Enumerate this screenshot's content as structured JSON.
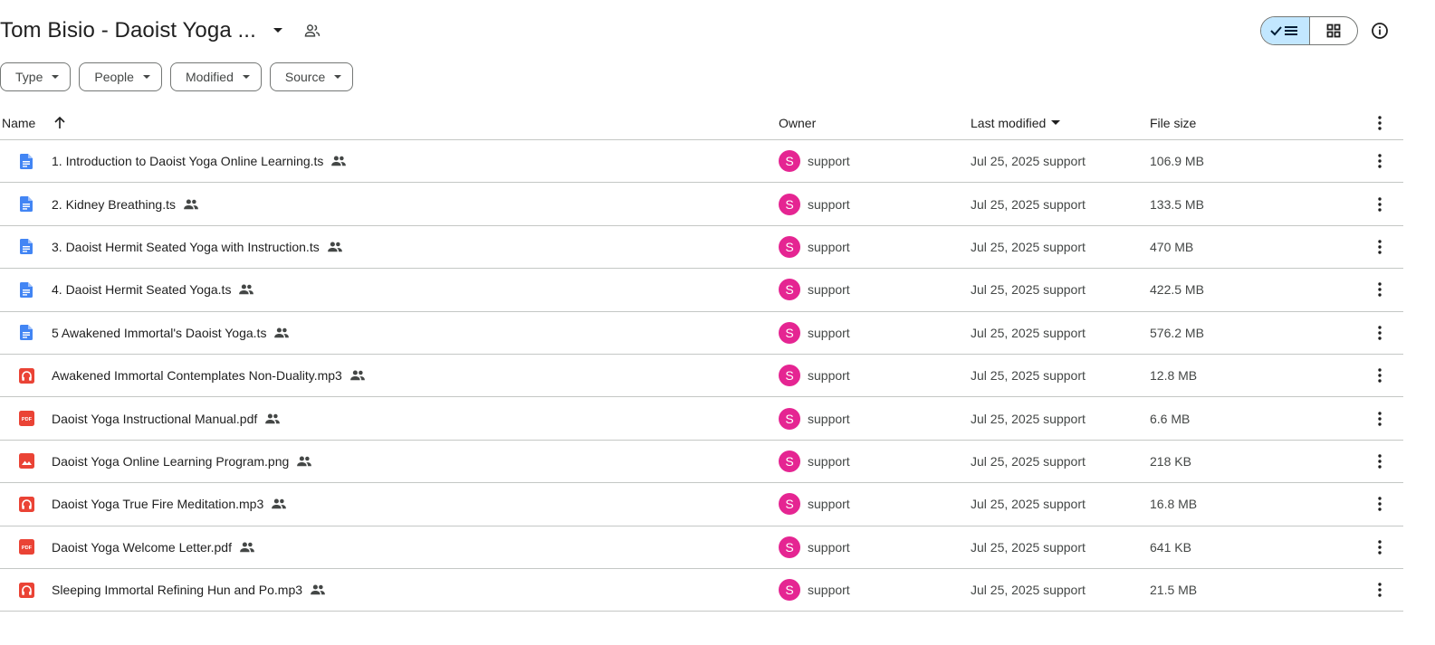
{
  "header": {
    "title": "Tom Bisio - Daoist Yoga ...",
    "caret_icon": "arrow-drop-down-icon",
    "shared_icon": "people-outline-icon"
  },
  "view_toggle": {
    "active": "list",
    "list_icon": "check-list-icon",
    "grid_icon": "grid-icon"
  },
  "info_icon": "info-icon",
  "filters": [
    {
      "label": "Type"
    },
    {
      "label": "People"
    },
    {
      "label": "Modified"
    },
    {
      "label": "Source"
    }
  ],
  "columns": {
    "name": "Name",
    "owner": "Owner",
    "modified": "Last modified",
    "size": "File size"
  },
  "colors": {
    "doc_blue": "#4285f4",
    "red": "#ea4335",
    "avatar_pink": "#e52592",
    "toggle_active": "#c2e7ff"
  },
  "files": [
    {
      "name": "1. Introduction to Daoist Yoga Online Learning.ts",
      "type": "doc",
      "owner_initial": "S",
      "owner": "support",
      "modified": "Jul 25, 2025 support",
      "size": "106.9 MB"
    },
    {
      "name": "2. Kidney Breathing.ts",
      "type": "doc",
      "owner_initial": "S",
      "owner": "support",
      "modified": "Jul 25, 2025 support",
      "size": "133.5 MB"
    },
    {
      "name": "3. Daoist Hermit Seated Yoga with Instruction.ts",
      "type": "doc",
      "owner_initial": "S",
      "owner": "support",
      "modified": "Jul 25, 2025 support",
      "size": "470 MB"
    },
    {
      "name": "4. Daoist Hermit Seated Yoga.ts",
      "type": "doc",
      "owner_initial": "S",
      "owner": "support",
      "modified": "Jul 25, 2025 support",
      "size": "422.5 MB"
    },
    {
      "name": "5 Awakened Immortal's Daoist Yoga.ts",
      "type": "doc",
      "owner_initial": "S",
      "owner": "support",
      "modified": "Jul 25, 2025 support",
      "size": "576.2 MB"
    },
    {
      "name": "Awakened Immortal Contemplates Non-Duality.mp3",
      "type": "audio",
      "owner_initial": "S",
      "owner": "support",
      "modified": "Jul 25, 2025 support",
      "size": "12.8 MB"
    },
    {
      "name": "Daoist Yoga Instructional Manual.pdf",
      "type": "pdf",
      "owner_initial": "S",
      "owner": "support",
      "modified": "Jul 25, 2025 support",
      "size": "6.6 MB"
    },
    {
      "name": "Daoist Yoga Online Learning Program.png",
      "type": "image",
      "owner_initial": "S",
      "owner": "support",
      "modified": "Jul 25, 2025 support",
      "size": "218 KB"
    },
    {
      "name": "Daoist Yoga True Fire Meditation.mp3",
      "type": "audio",
      "owner_initial": "S",
      "owner": "support",
      "modified": "Jul 25, 2025 support",
      "size": "16.8 MB"
    },
    {
      "name": "Daoist Yoga Welcome Letter.pdf",
      "type": "pdf",
      "owner_initial": "S",
      "owner": "support",
      "modified": "Jul 25, 2025 support",
      "size": "641 KB"
    },
    {
      "name": "Sleeping Immortal Refining Hun and Po.mp3",
      "type": "audio",
      "owner_initial": "S",
      "owner": "support",
      "modified": "Jul 25, 2025 support",
      "size": "21.5 MB"
    }
  ]
}
